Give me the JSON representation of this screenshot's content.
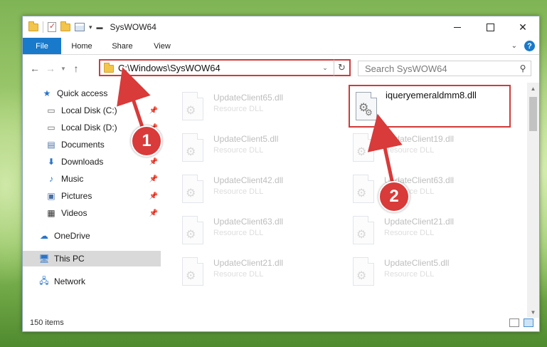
{
  "window": {
    "title": "SysWOW64"
  },
  "ribbon": {
    "tabs": [
      {
        "label": "File"
      },
      {
        "label": "Home"
      },
      {
        "label": "Share"
      },
      {
        "label": "View"
      }
    ]
  },
  "address": {
    "path": "C:\\Windows\\SysWOW64"
  },
  "search": {
    "placeholder": "Search SysWOW64"
  },
  "nav": {
    "items": [
      {
        "label": "Quick access",
        "icon": "star-icon"
      },
      {
        "label": "Local Disk (C:)",
        "icon": "drive-icon",
        "pinned": true
      },
      {
        "label": "Local Disk (D:)",
        "icon": "drive-icon",
        "pinned": true
      },
      {
        "label": "Documents",
        "icon": "document-icon",
        "pinned": true
      },
      {
        "label": "Downloads",
        "icon": "download-icon",
        "pinned": true
      },
      {
        "label": "Music",
        "icon": "music-icon",
        "pinned": true
      },
      {
        "label": "Pictures",
        "icon": "picture-icon",
        "pinned": true
      },
      {
        "label": "Videos",
        "icon": "video-icon",
        "pinned": true
      },
      {
        "label": "OneDrive",
        "icon": "cloud-icon"
      },
      {
        "label": "This PC",
        "icon": "computer-icon",
        "selected": true
      },
      {
        "label": "Network",
        "icon": "network-icon"
      }
    ]
  },
  "files": {
    "left": [
      {
        "name": "UpdateClient65.dll",
        "type": "Resource DLL"
      },
      {
        "name": "UpdateClient5.dll",
        "type": "Resource DLL"
      },
      {
        "name": "UpdateClient42.dll",
        "type": "Resource DLL"
      },
      {
        "name": "UpdateClient63.dll",
        "type": "Resource DLL"
      },
      {
        "name": "UpdateClient21.dll",
        "type": "Resource DLL"
      }
    ],
    "right": [
      {
        "name": "iqueryemeraldmm8.dll",
        "type": ""
      },
      {
        "name": "UpdateClient19.dll",
        "type": "Resource DLL"
      },
      {
        "name": "UpdateClient63.dll",
        "type": "Resource DLL"
      },
      {
        "name": "UpdateClient21.dll",
        "type": "Resource DLL"
      },
      {
        "name": "UpdateClient5.dll",
        "type": "Resource DLL"
      }
    ]
  },
  "status": {
    "count": "150 items"
  },
  "annotations": {
    "step1": "1",
    "step2": "2",
    "color": "#d93a3a"
  }
}
